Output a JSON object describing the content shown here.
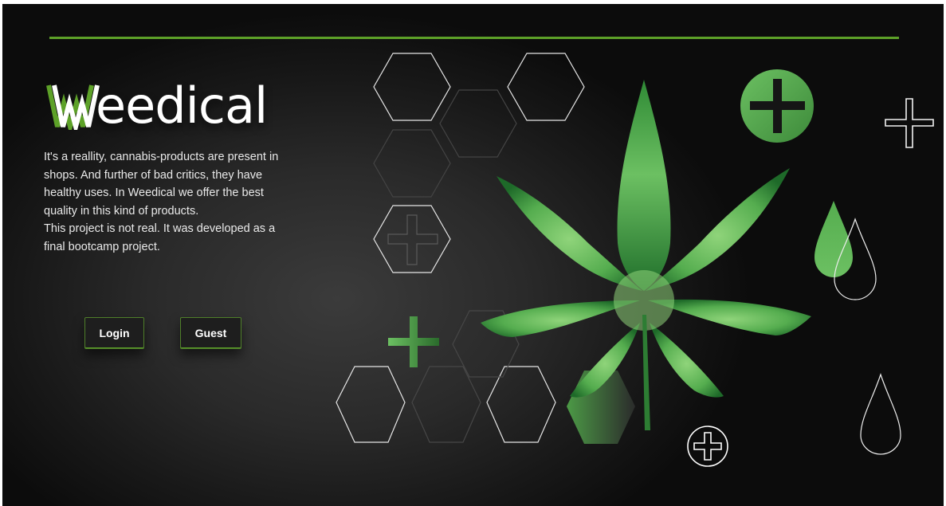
{
  "brand": {
    "name": "eedical",
    "icon": "W-zigzag-logo-icon"
  },
  "intro": {
    "paragraph1": "It's a reallity, cannabis-products are present in shops. And further of bad critics, they have healthy uses. In Weedical we offer the best quality in this kind of products.",
    "paragraph2": "This project is not real. It was developed as a final bootcamp project."
  },
  "buttons": {
    "login": "Login",
    "guest": "Guest"
  },
  "decorations": {
    "leaf": "cannabis-leaf-icon",
    "hexagons": "hexagon-outline-icon",
    "plus": "plus-icon",
    "drops": "drop-icon"
  },
  "colors": {
    "accent": "#5da128",
    "leaf_light": "#6cc062",
    "leaf_dark": "#1f6e2a",
    "background": "#1f1f1f"
  }
}
